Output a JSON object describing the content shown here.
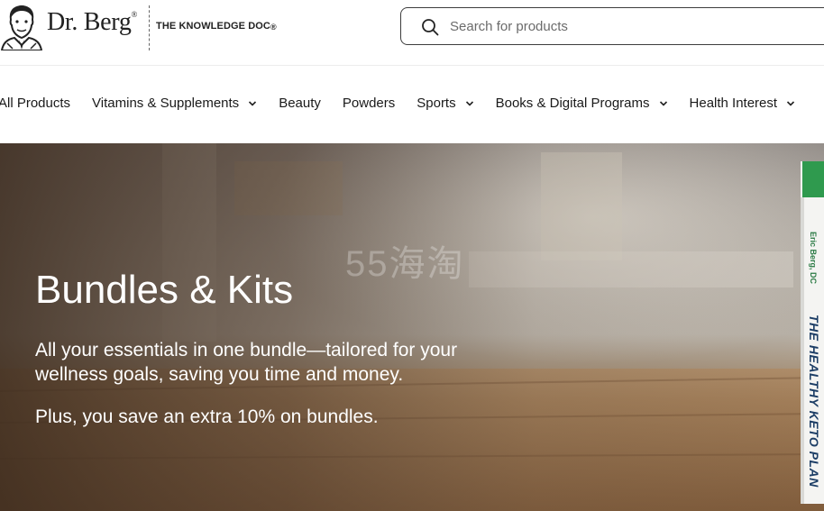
{
  "brand": {
    "name": "Dr. Berg",
    "registered": "®",
    "tagline": "THE KNOWLEDGE DOC",
    "tagline_registered": "®"
  },
  "search": {
    "placeholder": "Search for products",
    "icon": "search-icon"
  },
  "nav": {
    "items": [
      {
        "label": "All Products",
        "has_dropdown": false
      },
      {
        "label": "Vitamins & Supplements",
        "has_dropdown": true
      },
      {
        "label": "Beauty",
        "has_dropdown": false
      },
      {
        "label": "Powders",
        "has_dropdown": false
      },
      {
        "label": "Sports",
        "has_dropdown": true
      },
      {
        "label": "Books & Digital Programs",
        "has_dropdown": true
      },
      {
        "label": "Health Interest",
        "has_dropdown": true
      }
    ]
  },
  "hero": {
    "title": "Bundles & Kits",
    "text": "All your essentials in one bundle—tailored for your wellness goals, saving you time and money.",
    "subtext": "Plus, you save an extra 10% on bundles.",
    "watermark": "55海淘",
    "book_author": "Eric Berg, DC",
    "book_title": "THE HEALTHY KETO PLAN"
  },
  "colors": {
    "text": "#1a1a1a",
    "hero_text": "#ffffff",
    "search_border": "#3d3d3d",
    "book_accent_green": "#2a7a44",
    "book_title_blue": "#1d3e66"
  }
}
